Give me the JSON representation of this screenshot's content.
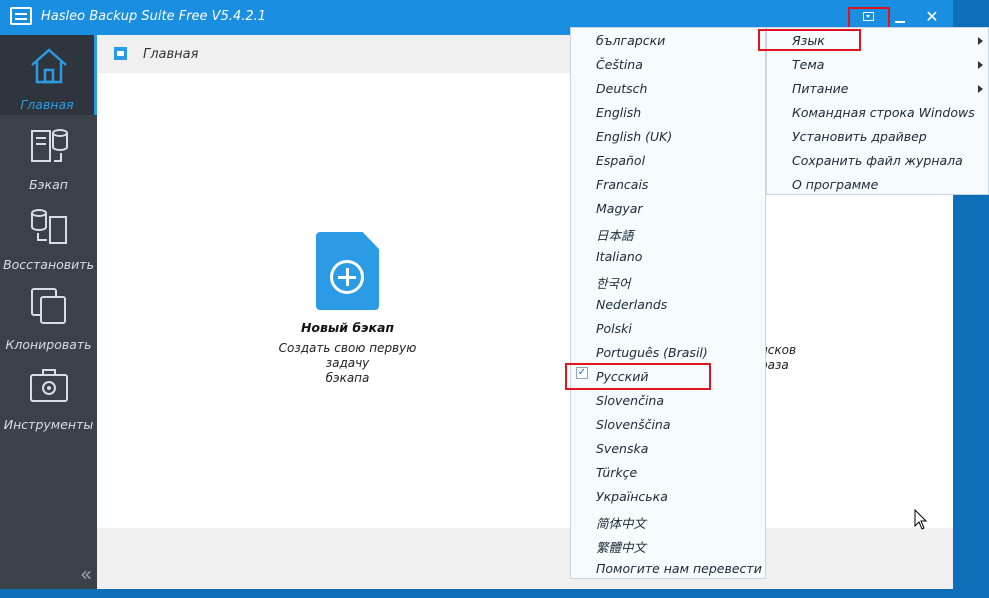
{
  "window": {
    "title": "Hasleo Backup Suite Free V5.4.2.1"
  },
  "titlebar": {
    "menu_icon": "dropdown-menu-icon",
    "close_label": "✕"
  },
  "sidebar": {
    "items": [
      {
        "label": "Главная",
        "icon": "home-icon"
      },
      {
        "label": "Бэкап",
        "icon": "backup-icon"
      },
      {
        "label": "Восстановить",
        "icon": "restore-icon"
      },
      {
        "label": "Клонировать",
        "icon": "clone-icon"
      },
      {
        "label": "Инструменты",
        "icon": "toolbox-icon"
      }
    ],
    "collapse_label": "«"
  },
  "breadcrumb": {
    "text": "Главная"
  },
  "cards": [
    {
      "title": "Новый бэкап",
      "desc_line1": "Создать свою первую задачу",
      "desc_line2": "бэкапа"
    },
    {
      "desc_line1": "исков",
      "desc_line2": "раза"
    }
  ],
  "language_menu": {
    "items": [
      "български",
      "Čeština",
      "Deutsch",
      "English",
      "English (UK)",
      "Español",
      "Francais",
      "Magyar",
      "日本語",
      "Italiano",
      "한국어",
      "Nederlands",
      "Polski",
      "Português (Brasil)",
      "Русский",
      "Slovenčina",
      "Slovenščina",
      "Svenska",
      "Türkçe",
      "Українська",
      "简体中文",
      "繁體中文",
      "Помогите нам перевести"
    ],
    "selected": "Русский",
    "check": "✓"
  },
  "main_menu": {
    "items": [
      "Язык",
      "Тема",
      "Питание",
      "Командная строка Windows",
      "Установить драйвер",
      "Сохранить файл журнала",
      "О программе"
    ]
  },
  "colors": {
    "accent": "#2c9be6",
    "titlebar": "#1a8ee0",
    "sidebar": "#3a4149",
    "highlight": "#e0141e"
  }
}
